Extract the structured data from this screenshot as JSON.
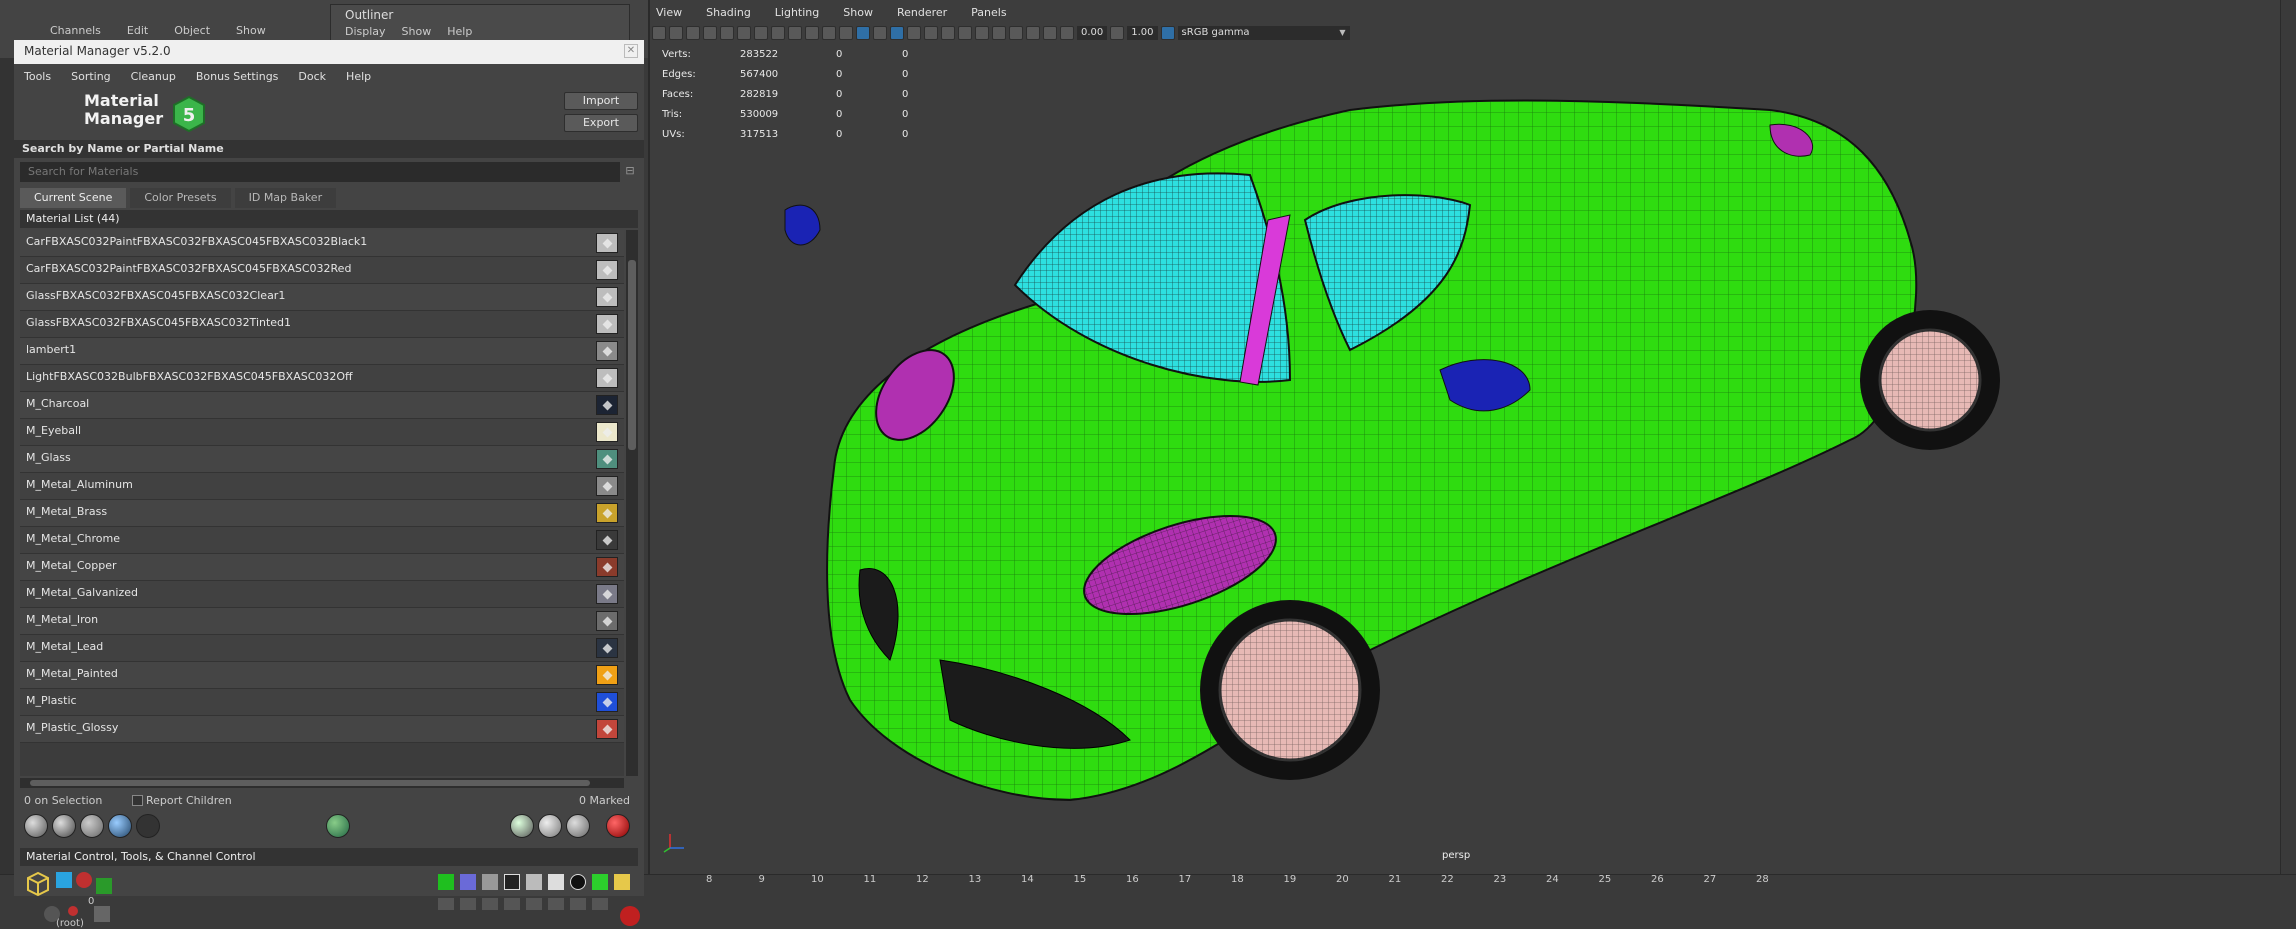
{
  "background": {
    "menu": [
      "Channels",
      "Edit",
      "Object",
      "Show"
    ],
    "outliner": {
      "title": "Outliner",
      "menu": [
        "Display",
        "Show",
        "Help"
      ]
    }
  },
  "material_manager": {
    "title": "Material Manager v5.2.0",
    "menu": [
      "Tools",
      "Sorting",
      "Cleanup",
      "Bonus Settings",
      "Dock",
      "Help"
    ],
    "logo": {
      "line1": "Material",
      "line2": "Manager",
      "badge": "5"
    },
    "import_label": "Import",
    "export_label": "Export",
    "search_header": "Search by Name or Partial Name",
    "search_placeholder": "Search for Materials",
    "tabs": [
      "Current Scene",
      "Color Presets",
      "ID Map Baker"
    ],
    "list_header": "Material List  (44)",
    "materials": [
      {
        "name": "CarFBXASC032PaintFBXASC032FBXASC045FBXASC032Black1",
        "color": "#bdbdbd"
      },
      {
        "name": "CarFBXASC032PaintFBXASC032FBXASC045FBXASC032Red",
        "color": "#bdbdbd"
      },
      {
        "name": "GlassFBXASC032FBXASC045FBXASC032Clear1",
        "color": "#bdbdbd"
      },
      {
        "name": "GlassFBXASC032FBXASC045FBXASC032Tinted1",
        "color": "#bdbdbd"
      },
      {
        "name": "lambert1",
        "color": "#8a8a8a"
      },
      {
        "name": "LightFBXASC032BulbFBXASC032FBXASC045FBXASC032Off",
        "color": "#bdbdbd"
      },
      {
        "name": "M_Charcoal",
        "color": "#1c2433"
      },
      {
        "name": "M_Eyeball",
        "color": "#ece8cc"
      },
      {
        "name": "M_Glass",
        "color": "#4f8f7e"
      },
      {
        "name": "M_Metal_Aluminum",
        "color": "#8a8a8a"
      },
      {
        "name": "M_Metal_Brass",
        "color": "#c9a22b"
      },
      {
        "name": "M_Metal_Chrome",
        "color": "#3a3a3a"
      },
      {
        "name": "M_Metal_Copper",
        "color": "#8a3b2b"
      },
      {
        "name": "M_Metal_Galvanized",
        "color": "#7a7a88"
      },
      {
        "name": "M_Metal_Iron",
        "color": "#6c6c6c"
      },
      {
        "name": "M_Metal_Lead",
        "color": "#2b3442"
      },
      {
        "name": "M_Metal_Painted",
        "color": "#f0a015"
      },
      {
        "name": "M_Plastic",
        "color": "#1f4fd8"
      },
      {
        "name": "M_Plastic_Glossy",
        "color": "#c2463b"
      }
    ],
    "selection": {
      "count": "0 on Selection",
      "report_children": "Report Children",
      "marked": "0 Marked"
    },
    "control_header": "Material Control, Tools, & Channel Control",
    "root_label": "(root)"
  },
  "viewport": {
    "menu": [
      "View",
      "Shading",
      "Lighting",
      "Show",
      "Renderer",
      "Panels"
    ],
    "field_a": "0.00",
    "field_b": "1.00",
    "color_space": "sRGB gamma",
    "hud": [
      {
        "label": "Verts:",
        "v1": "283522",
        "v2": "0",
        "v3": "0"
      },
      {
        "label": "Edges:",
        "v1": "567400",
        "v2": "0",
        "v3": "0"
      },
      {
        "label": "Faces:",
        "v1": "282819",
        "v2": "0",
        "v3": "0"
      },
      {
        "label": "Tris:",
        "v1": "530009",
        "v2": "0",
        "v3": "0"
      },
      {
        "label": "UVs:",
        "v1": "317513",
        "v2": "0",
        "v3": "0"
      }
    ],
    "camera": "persp"
  },
  "timeline": {
    "start": "0",
    "ticks": [
      "8",
      "9",
      "10",
      "11",
      "12",
      "13",
      "14",
      "15",
      "16",
      "17",
      "18",
      "19",
      "20",
      "21",
      "22",
      "23",
      "24",
      "25",
      "26",
      "27",
      "28"
    ]
  }
}
